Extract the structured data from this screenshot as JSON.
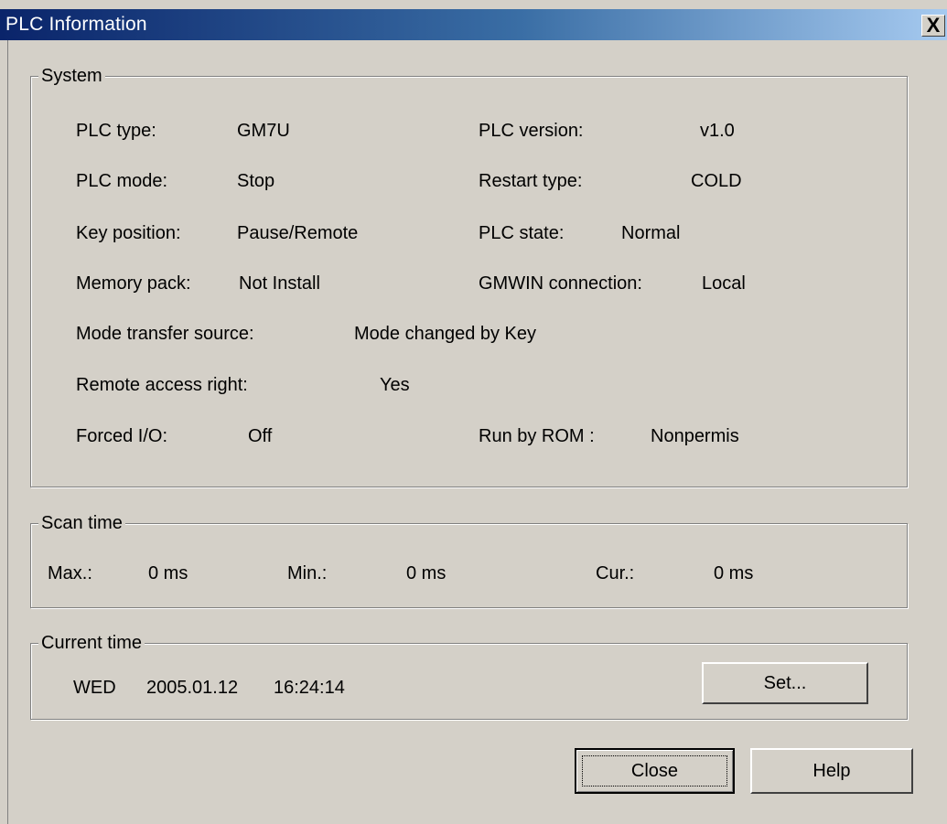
{
  "window": {
    "title": "PLC Information",
    "close_glyph": "X"
  },
  "system": {
    "label": "System",
    "plc_type_label": "PLC type:",
    "plc_type_value": "GM7U",
    "plc_version_label": "PLC version:",
    "plc_version_value": "v1.0",
    "plc_mode_label": "PLC mode:",
    "plc_mode_value": "Stop",
    "restart_type_label": "Restart type:",
    "restart_type_value": "COLD",
    "key_position_label": "Key position:",
    "key_position_value": "Pause/Remote",
    "plc_state_label": "PLC state:",
    "plc_state_value": "Normal",
    "memory_pack_label": "Memory pack:",
    "memory_pack_value": "Not Install",
    "gmwin_connection_label": "GMWIN connection:",
    "gmwin_connection_value": "Local",
    "mode_transfer_label": "Mode transfer source:",
    "mode_transfer_value": "Mode changed by Key",
    "remote_access_label": "Remote access right:",
    "remote_access_value": "Yes",
    "forced_io_label": "Forced I/O:",
    "forced_io_value": "Off",
    "run_by_rom_label": "Run by ROM :",
    "run_by_rom_value": "Nonpermis"
  },
  "scan_time": {
    "label": "Scan time",
    "max_label": "Max.:",
    "max_value": "0 ms",
    "min_label": "Min.:",
    "min_value": "0 ms",
    "cur_label": "Cur.:",
    "cur_value": "0 ms"
  },
  "current_time": {
    "label": "Current time",
    "day": "WED",
    "date": "2005.01.12",
    "time": "16:24:14",
    "set_button": "Set..."
  },
  "buttons": {
    "close": "Close",
    "help": "Help"
  }
}
